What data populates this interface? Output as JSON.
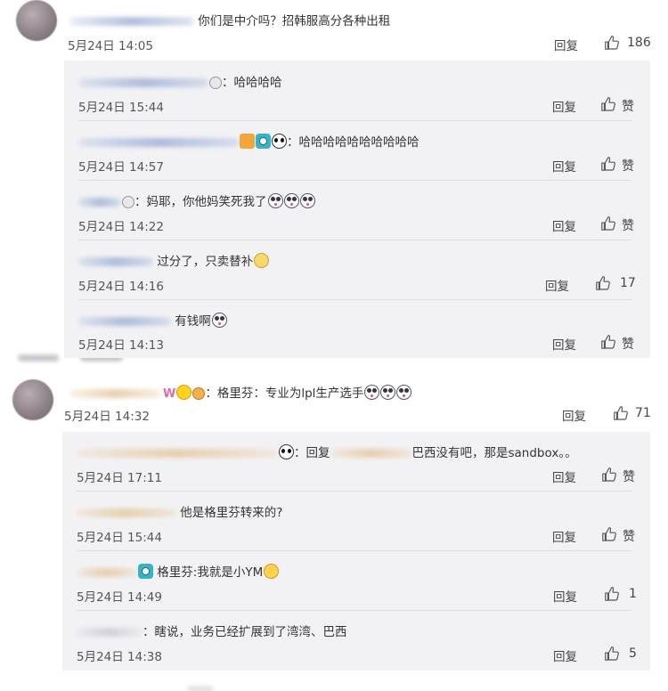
{
  "ui": {
    "reply_label": "回复",
    "like_label": "赞"
  },
  "comments": [
    {
      "text": "你们是中介吗？招韩服高分各种出租",
      "time": "5月24日 14:05",
      "likes": "186",
      "replies": [
        {
          "text": "：哈哈哈哈",
          "time": "5月24日 15:44",
          "likes": "赞"
        },
        {
          "text": "：哈哈哈哈哈哈哈哈哈哈",
          "time": "5月24日 14:57",
          "likes": "赞"
        },
        {
          "text": "：妈耶，你他妈笑死我了",
          "time": "5月24日 14:22",
          "likes": "赞"
        },
        {
          "text": "过分了，只卖替补",
          "time": "5月24日 14:16",
          "likes": "17"
        },
        {
          "text": "有钱啊",
          "time": "5月24日 14:13",
          "likes": "赞"
        }
      ]
    },
    {
      "text": "：格里芬：专业为lpl生产选手",
      "time": "5月24日 14:32",
      "likes": "71",
      "replies": [
        {
          "text_prefix": "：回复",
          "text": "巴西没有吧，那是sandbox。。",
          "time": "5月24日 17:11",
          "likes": "赞"
        },
        {
          "text": "他是格里芬转来的?",
          "time": "5月24日 15:44",
          "likes": "赞"
        },
        {
          "text": "格里芬:我就是小YM",
          "time": "5月24日 14:49",
          "likes": "1"
        },
        {
          "text": "：瞎说，业务已经扩展到了湾湾、巴西",
          "time": "5月24日 14:38",
          "likes": "5"
        }
      ]
    }
  ],
  "icons": {
    "like": "thumbs-up-icon",
    "avatar": "user-avatar"
  },
  "colors": {
    "reply_bg": "#f2f2f5",
    "text": "#333333",
    "meta": "#555555"
  }
}
